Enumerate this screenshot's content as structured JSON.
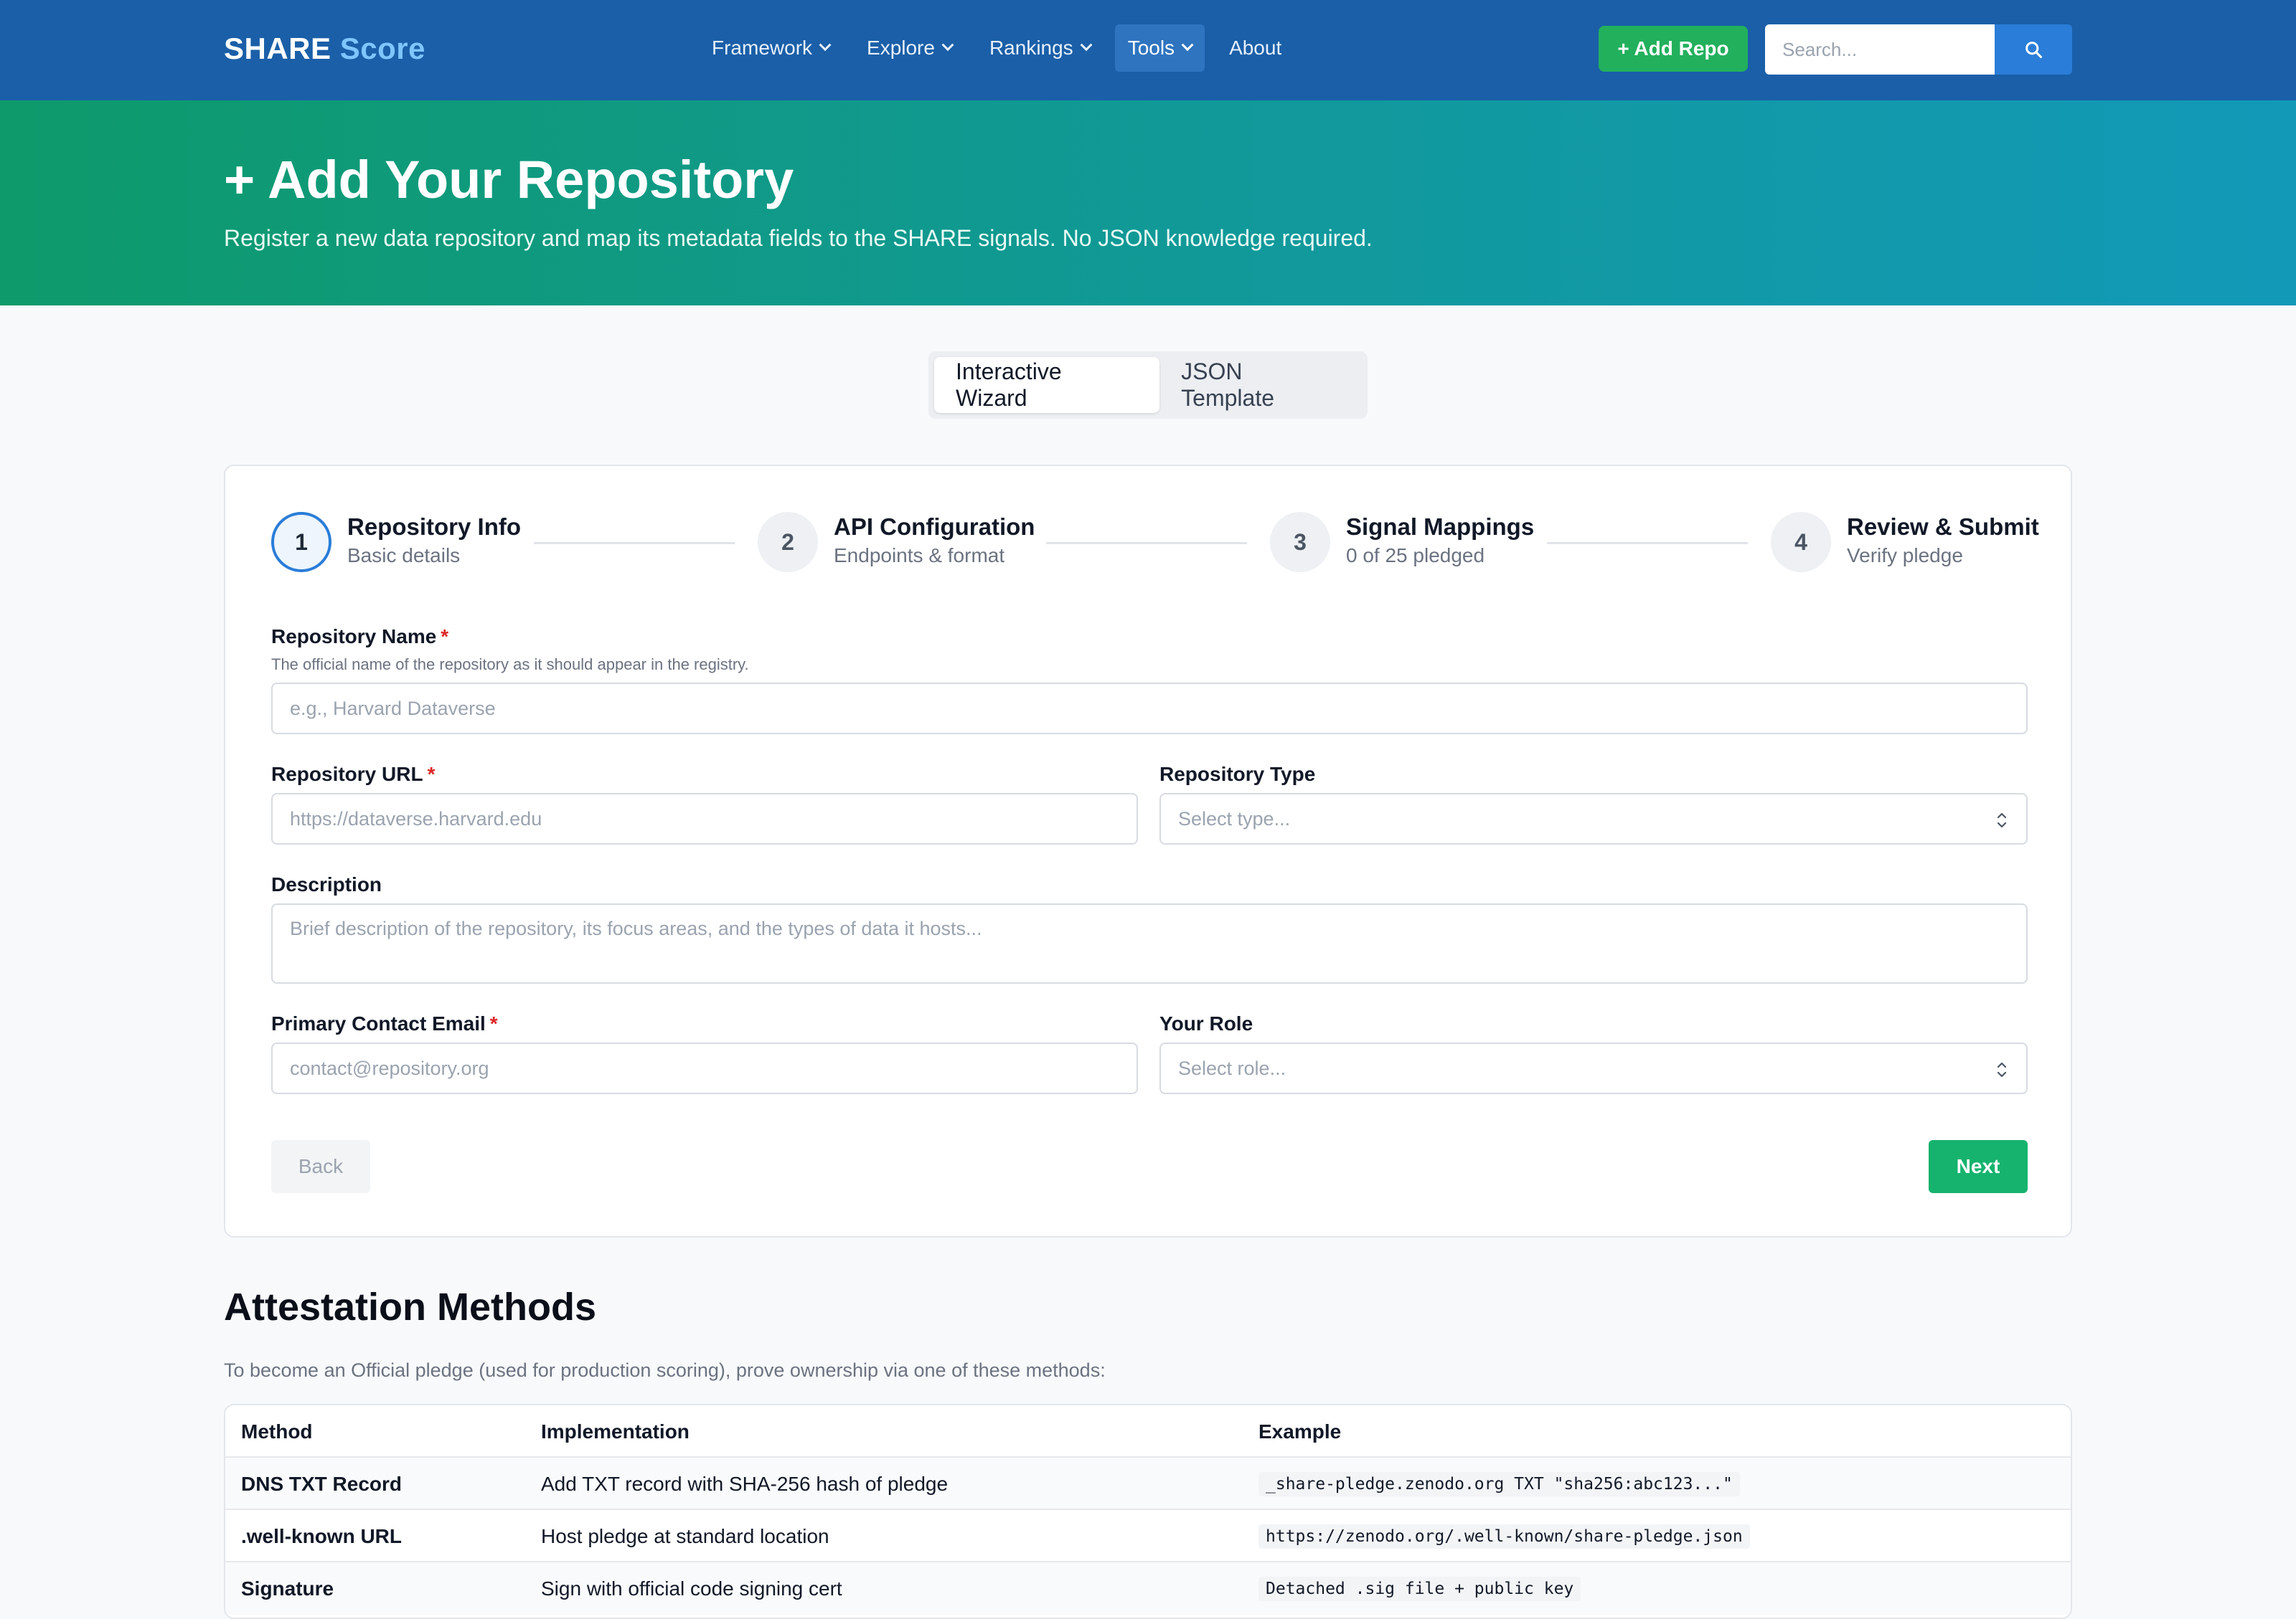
{
  "navbar": {
    "brand_main": "SHARE",
    "brand_accent": "Score",
    "links": [
      {
        "label": "Framework",
        "has_dropdown": true
      },
      {
        "label": "Explore",
        "has_dropdown": true
      },
      {
        "label": "Rankings",
        "has_dropdown": true
      },
      {
        "label": "Tools",
        "has_dropdown": true,
        "active": true
      },
      {
        "label": "About",
        "has_dropdown": false
      }
    ],
    "add_repo_label": "+ Add Repo",
    "search_placeholder": "Search...",
    "search_icon": "search-icon"
  },
  "hero": {
    "title": "+ Add Your Repository",
    "subtitle": "Register a new data repository and map its metadata fields to the SHARE signals. No JSON knowledge required."
  },
  "mode_tabs": [
    {
      "label": "Interactive Wizard",
      "active": true
    },
    {
      "label": "JSON Template",
      "active": false
    }
  ],
  "wizard": {
    "steps": [
      {
        "number": "1",
        "title": "Repository Info",
        "subtitle": "Basic details",
        "active": true
      },
      {
        "number": "2",
        "title": "API Configuration",
        "subtitle": "Endpoints & format",
        "active": false
      },
      {
        "number": "3",
        "title": "Signal Mappings",
        "subtitle": "0 of 25 pledged",
        "active": false
      },
      {
        "number": "4",
        "title": "Review & Submit",
        "subtitle": "Verify pledge",
        "active": false
      }
    ],
    "fields": {
      "repo_name": {
        "label": "Repository Name",
        "required_mark": "*",
        "help": "The official name of the repository as it should appear in the registry.",
        "placeholder": "e.g., Harvard Dataverse"
      },
      "repo_url": {
        "label": "Repository URL",
        "required_mark": "*",
        "placeholder": "https://dataverse.harvard.edu"
      },
      "repo_type": {
        "label": "Repository Type",
        "placeholder": "Select type..."
      },
      "description": {
        "label": "Description",
        "placeholder": "Brief description of the repository, its focus areas, and the types of data it hosts..."
      },
      "contact_email": {
        "label": "Primary Contact Email",
        "required_mark": "*",
        "placeholder": "contact@repository.org"
      },
      "role": {
        "label": "Your Role",
        "placeholder": "Select role..."
      }
    },
    "back_label": "Back",
    "next_label": "Next"
  },
  "attestation": {
    "title": "Attestation Methods",
    "intro": "To become an Official pledge (used for production scoring), prove ownership via one of these methods:",
    "headers": [
      "Method",
      "Implementation",
      "Example"
    ],
    "rows": [
      {
        "method": "DNS TXT Record",
        "implementation": "Add TXT record with SHA-256 hash of pledge",
        "example": "_share-pledge.zenodo.org TXT \"sha256:abc123...\""
      },
      {
        "method": ".well-known URL",
        "implementation": "Host pledge at standard location",
        "example": "https://zenodo.org/.well-known/share-pledge.json"
      },
      {
        "method": "Signature",
        "implementation": "Sign with official code signing cert",
        "example": "Detached .sig file + public key"
      }
    ]
  },
  "colors": {
    "navbar": "#1a5fa8",
    "brand_accent": "#7ec6ff",
    "add_repo": "#22b05d",
    "hero_start": "#0e9a6a",
    "hero_end": "#1299b8",
    "next_button": "#16b36e",
    "active_step_ring": "#2a7dd8",
    "required": "#dc2626"
  }
}
